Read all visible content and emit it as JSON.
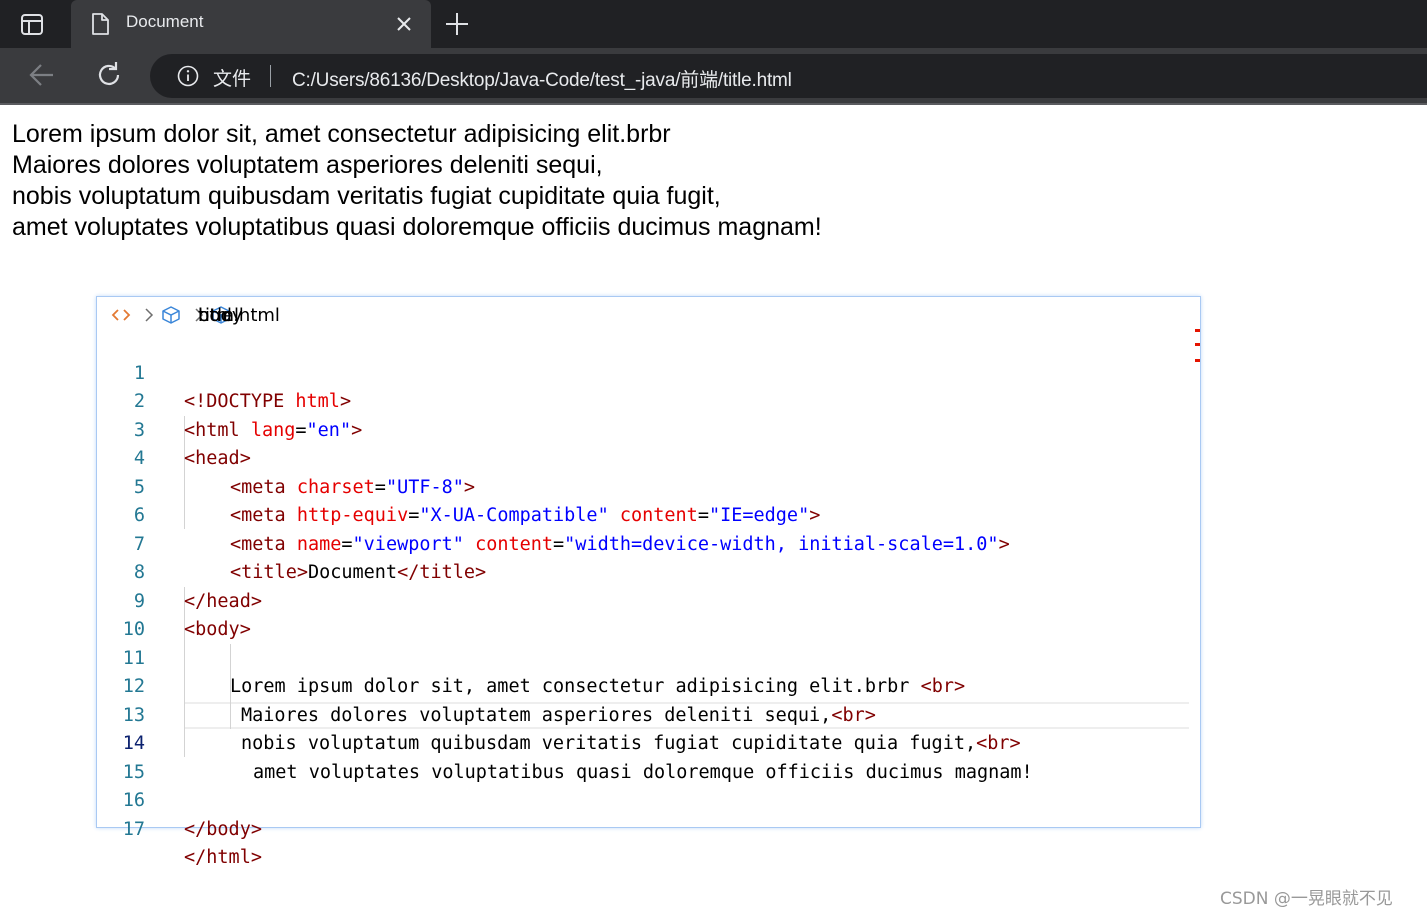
{
  "browser": {
    "tab": {
      "title": "Document"
    },
    "address": {
      "label": "文件",
      "url": "C:/Users/86136/Desktop/Java-Code/test_-java/前端/title.html"
    }
  },
  "page": {
    "lines": [
      "Lorem ipsum dolor sit, amet consectetur adipisicing elit.brbr",
      "Maiores dolores voluptatem asperiores deleniti sequi,",
      "nobis voluptatum quibusdam veritatis fugiat cupiditate quia fugit,",
      "amet voluptates voluptatibus quasi doloremque officiis ducimus magnam!"
    ]
  },
  "editor": {
    "breadcrumbs": [
      "title.html",
      "html",
      "body"
    ],
    "line_numbers": [
      "1",
      "2",
      "3",
      "4",
      "5",
      "6",
      "7",
      "8",
      "9",
      "10",
      "11",
      "12",
      "13",
      "14",
      "15",
      "16",
      "17"
    ],
    "active_line": "14",
    "code": {
      "l1": {
        "open": "<!DOCTYPE ",
        "kw": "html",
        "close": ">"
      },
      "l2": {
        "open": "<html ",
        "attr": "lang",
        "eq": "=",
        "val": "\"en\"",
        "close": ">"
      },
      "l3": {
        "tag": "<head>"
      },
      "l4": {
        "open": "<meta ",
        "attr": "charset",
        "eq": "=",
        "val": "\"UTF-8\"",
        "close": ">"
      },
      "l5": {
        "open": "<meta ",
        "attr1": "http-equiv",
        "eq1": "=",
        "val1": "\"X-UA-Compatible\"",
        "sp": " ",
        "attr2": "content",
        "eq2": "=",
        "val2": "\"IE=edge\"",
        "close": ">"
      },
      "l6": {
        "open": "<meta ",
        "attr1": "name",
        "eq1": "=",
        "val1": "\"viewport\"",
        "sp": " ",
        "attr2": "content",
        "eq2": "=",
        "val2": "\"width=device-width, initial-scale=1.0\"",
        "close": ">"
      },
      "l7": {
        "open": "<title>",
        "text": "Document",
        "close": "</title>"
      },
      "l8": {
        "tag": "</head>"
      },
      "l9": {
        "tag": "<body>"
      },
      "l11": {
        "text": "Lorem ipsum dolor sit, amet consectetur adipisicing elit.brbr ",
        "tag": "<br>"
      },
      "l12": {
        "text": "Maiores dolores voluptatem asperiores deleniti sequi,",
        "tag": "<br>"
      },
      "l13": {
        "text": "nobis voluptatum quibusdam veritatis fugiat cupiditate quia fugit,",
        "tag": "<br>"
      },
      "l14": {
        "text": "amet voluptates voluptatibus quasi doloremque officiis ducimus magnam!"
      },
      "l16": {
        "tag": "</body>"
      },
      "l17": {
        "tag": "</html>"
      }
    }
  },
  "watermark": "CSDN @一晃眼就不见",
  "colors": {
    "tag": "#800000",
    "attribute": "#e50000",
    "value": "#0000ff",
    "line_number": "#237893"
  }
}
